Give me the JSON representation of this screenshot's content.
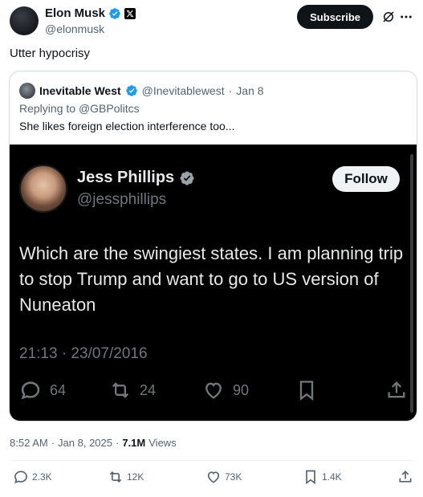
{
  "author": {
    "name": "Elon Musk",
    "handle": "@elonmusk"
  },
  "header": {
    "subscribe_label": "Subscribe"
  },
  "tweet": {
    "text": "Utter hypocrisy"
  },
  "quote": {
    "author_name": "Inevitable West",
    "author_handle": "@Inevitablewest",
    "separator": "·",
    "date": "Jan 8",
    "replying_prefix": "Replying to ",
    "replying_handle": "@GBPolitcs",
    "text": "She likes foreign election interference too..."
  },
  "media": {
    "name": "Jess Phillips",
    "handle": "@jessphillips",
    "follow_label": "Follow",
    "text": "Which are the swingiest states. I am planning trip to stop Trump and want to go to US version of Nuneaton",
    "timestamp": "21:13 · 23/07/2016",
    "replies": "64",
    "reposts": "24",
    "likes": "90"
  },
  "meta": {
    "time": "8:52 AM",
    "sep1": "·",
    "date": "Jan 8, 2025",
    "sep2": "·",
    "views": "7.1M",
    "views_label": "Views"
  },
  "actions": {
    "replies": "2.3K",
    "reposts": "12K",
    "likes": "73K",
    "bookmarks": "1.4K"
  },
  "colors": {
    "verified_blue": "#1d9bf0",
    "text_primary": "#0f1419",
    "text_secondary": "#536471",
    "media_bg": "#000000"
  }
}
